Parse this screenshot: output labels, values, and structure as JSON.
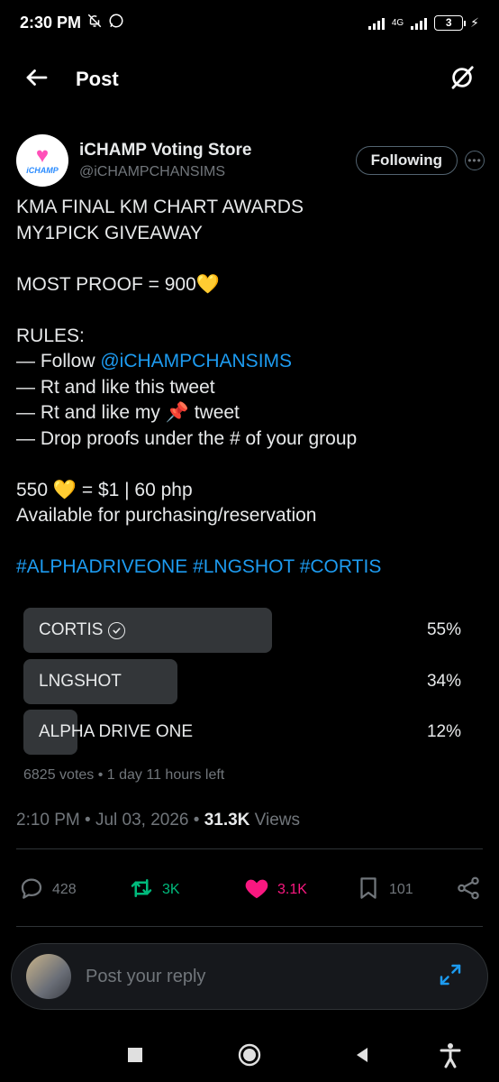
{
  "status_bar": {
    "time": "2:30 PM",
    "network": "4G",
    "battery": "3"
  },
  "header": {
    "back_icon": "arrow-left-icon",
    "title": "Post",
    "grok_icon": "grok-icon"
  },
  "author": {
    "avatar_text": "iCHAMP",
    "name": "iCHAMP Voting Store",
    "handle": "@iCHAMPCHANSIMS",
    "follow_label": "Following"
  },
  "post": {
    "line1": "KMA FINAL KM CHART AWARDS",
    "line2": "MY1PICK GIVEAWAY",
    "line3": "MOST PROOF = 900💛",
    "line4": "RULES:",
    "line5_prefix": "— Follow ",
    "line5_mention": "@iCHAMPCHANSIMS",
    "line6": "— Rt and like this tweet",
    "line7": "— Rt and like my 📌 tweet",
    "line8": "— Drop proofs under the # of your group",
    "line9": "550 💛 = $1 | 60 php",
    "line10": "Available for purchasing/reservation",
    "hashtags": "#ALPHADRIVEONE #LNGSHOT #CORTIS"
  },
  "poll": {
    "options": [
      {
        "label": "CORTIS",
        "percent": "55%",
        "fill": 0.55,
        "selected": true
      },
      {
        "label": "LNGSHOT",
        "percent": "34%",
        "fill": 0.34,
        "selected": false
      },
      {
        "label": "ALPHA DRIVE ONE",
        "percent": "12%",
        "fill": 0.12,
        "selected": false
      }
    ],
    "meta": "6825 votes • 1 day 11 hours left"
  },
  "timestamp": {
    "time": "2:10 PM • Jul 03, 2026 • ",
    "views_count": "31.3K",
    "views_label": " Views"
  },
  "actions": {
    "replies": "428",
    "reposts": "3K",
    "likes": "3.1K",
    "bookmarks": "101"
  },
  "reply_box": {
    "placeholder": "Post your reply"
  },
  "colors": {
    "accent": "#1d9bf0",
    "repost": "#00ba7c",
    "like": "#f91880",
    "muted": "#71767b",
    "poll_bar": "#333639"
  }
}
